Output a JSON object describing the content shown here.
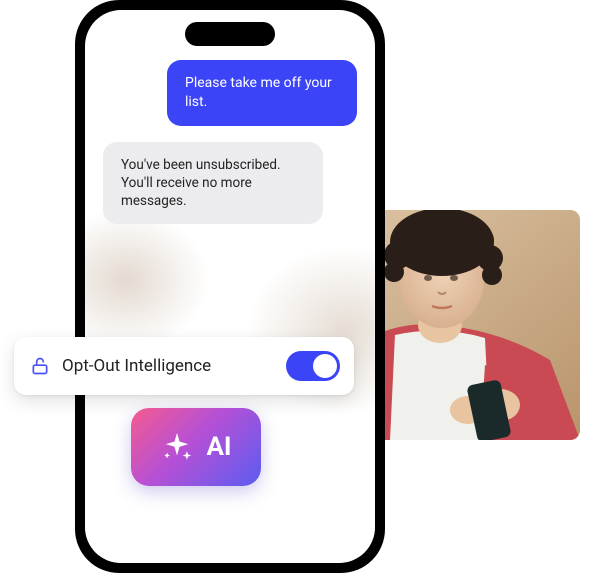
{
  "messages": {
    "user": "Please take me off your list.",
    "system": "You've been unsubscribed. You'll receive no more messages."
  },
  "optout": {
    "label": "Opt-Out Intelligence",
    "enabled": true
  },
  "ai_badge": {
    "label": "AI"
  },
  "colors": {
    "accent": "#3b44f6"
  }
}
